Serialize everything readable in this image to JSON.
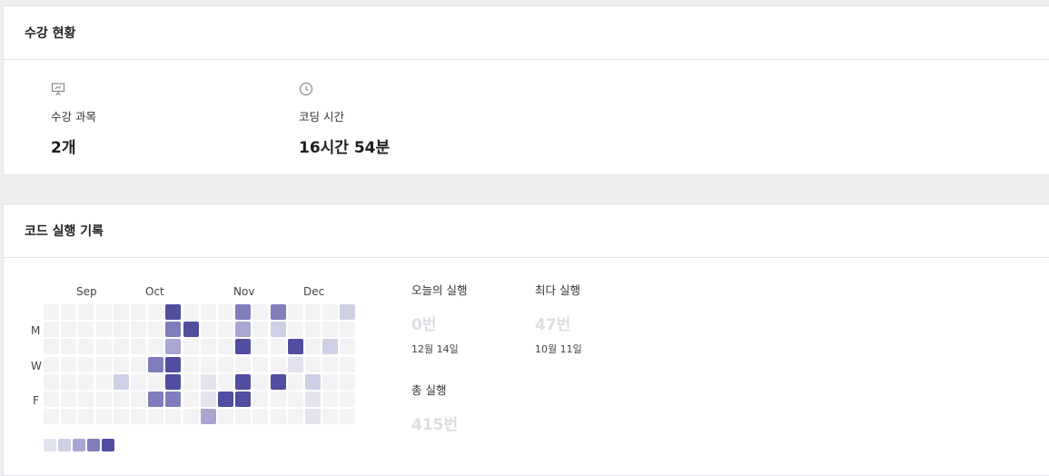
{
  "status_card": {
    "title": "수강 현황",
    "courses": {
      "icon": "presentation-icon",
      "label": "수강 과목",
      "value": "2개"
    },
    "coding_time": {
      "icon": "clock-icon",
      "label": "코딩 시간",
      "value": "16시간 54분"
    }
  },
  "code_card": {
    "title": "코드 실행 기록",
    "heatmap": {
      "months": [
        "Sep",
        "Oct",
        "Nov",
        "Dec"
      ],
      "day_labels": [
        "M",
        "W",
        "F"
      ],
      "levels_colors": [
        "#f3f3f5",
        "#e3e3ef",
        "#cfcfe5",
        "#a9a7d2",
        "#807dbd",
        "#514d9f"
      ],
      "legend_levels": [
        1,
        2,
        3,
        4,
        5
      ],
      "grid": [
        [
          0,
          0,
          0,
          0,
          0,
          0,
          0,
          5,
          0,
          0,
          0,
          4,
          0,
          4,
          0,
          0,
          0,
          2
        ],
        [
          0,
          0,
          0,
          0,
          0,
          0,
          0,
          4,
          5,
          0,
          0,
          3,
          0,
          2,
          0,
          0,
          0,
          0
        ],
        [
          0,
          0,
          0,
          0,
          0,
          0,
          0,
          3,
          0,
          0,
          0,
          5,
          0,
          0,
          5,
          0,
          2,
          0
        ],
        [
          0,
          0,
          0,
          0,
          0,
          0,
          4,
          5,
          0,
          0,
          0,
          0,
          0,
          0,
          1,
          0,
          0,
          0
        ],
        [
          0,
          0,
          0,
          0,
          2,
          0,
          0,
          5,
          0,
          1,
          0,
          5,
          0,
          5,
          0,
          2,
          0,
          0
        ],
        [
          0,
          0,
          0,
          0,
          0,
          0,
          4,
          4,
          0,
          1,
          5,
          5,
          0,
          0,
          0,
          1,
          0,
          0
        ],
        [
          0,
          0,
          0,
          0,
          0,
          0,
          0,
          0,
          0,
          3,
          0,
          0,
          0,
          0,
          0,
          1,
          0,
          0
        ]
      ]
    },
    "today": {
      "label": "오늘의 실행",
      "value": "0번",
      "date": "12월 14일"
    },
    "max": {
      "label": "최다 실행",
      "value": "47번",
      "date": "10월 11일"
    },
    "total": {
      "label": "총 실행",
      "value": "415번"
    }
  }
}
